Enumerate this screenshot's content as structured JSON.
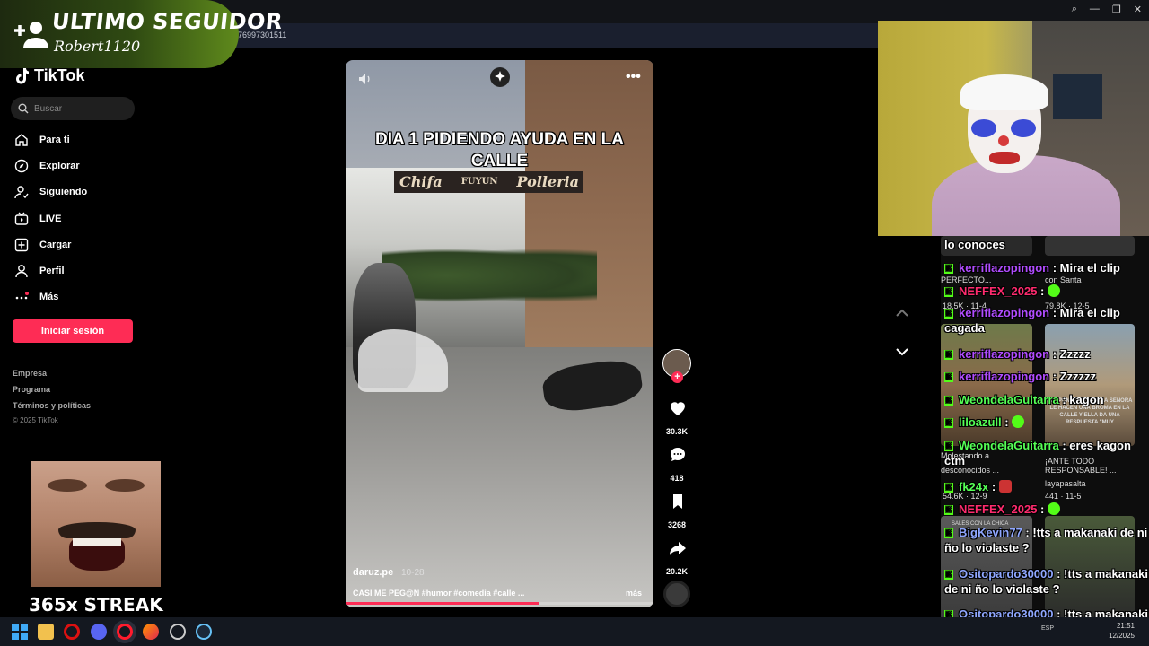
{
  "browser": {
    "url_fragment": "76997301511",
    "window_icons": [
      "search-icon",
      "minimize-icon",
      "restore-icon",
      "close-icon"
    ]
  },
  "follower_alert": {
    "title": "ULTIMO SEGUIDOR",
    "username": "Robert1120"
  },
  "sidebar": {
    "brand": "TikTok",
    "search_placeholder": "Buscar",
    "nav": [
      {
        "label": "Para ti",
        "icon": "home-icon"
      },
      {
        "label": "Explorar",
        "icon": "compass-icon"
      },
      {
        "label": "Siguiendo",
        "icon": "following-icon"
      },
      {
        "label": "LIVE",
        "icon": "live-icon"
      },
      {
        "label": "Cargar",
        "icon": "upload-icon"
      },
      {
        "label": "Perfil",
        "icon": "profile-icon"
      },
      {
        "label": "Más",
        "icon": "more-icon"
      }
    ],
    "login_label": "Iniciar sesión",
    "footer_links": [
      "Empresa",
      "Programa",
      "Términos y políticas"
    ],
    "copyright": "© 2025 TikTok"
  },
  "overlay": {
    "streak": "365x STREAK"
  },
  "video": {
    "caption": "DIA 1 PIDIENDO AYUDA EN LA CALLE",
    "sign_left": "Chifa",
    "sign_mid": "FUYUN",
    "sign_right": "Polleria",
    "author": "daruz.pe",
    "date": "10-28",
    "description": "CASI ME PEG@N #humor #comedia #calle ...",
    "more_label": "más",
    "progress": 0.63
  },
  "actions": {
    "likes": "30.3K",
    "comments": "418",
    "saves": "3268",
    "shares": "20.2K"
  },
  "grid_texts": {
    "t1": "PERFECTO...",
    "t2": "con Santa",
    "t3": "18.5K · 11-4",
    "t4": "79.8K · 12-5",
    "t5": "Molestando a",
    "t6": "desconocidos ...",
    "t7": "¡ANTE TODO",
    "t8": "RESPONSABLE! ...",
    "t9": "layapasalta",
    "t10": "54.6K · 12-9",
    "t11": "441 · 11-5",
    "t12": "RESPONSABLE! A UNA SEÑORA LE HACEN UNA BROMA EN LA CALLE Y ELLA DA UNA RESPUESTA \"MUY",
    "t13": "SALES CON LA CHICA"
  },
  "chat": [
    {
      "user": "",
      "text": "lo conoces",
      "color": "#ffffff"
    },
    {
      "user": "kerriflazopingon",
      "text": " : Mira el clip",
      "color": "#b14cff"
    },
    {
      "user": "NEFFEX_2025",
      "text": " : ",
      "color": "#ff2b6e"
    },
    {
      "user": "kerriflazopingon",
      "text": " : Mira el clip cagada",
      "color": "#b14cff"
    },
    {
      "user": "kerriflazopingon",
      "text": " : Zzzzz",
      "color": "#b14cff"
    },
    {
      "user": "kerriflazopingon",
      "text": " : Zzzzzz",
      "color": "#b14cff"
    },
    {
      "user": "WeondelaGuitarra",
      "text": " : kagon",
      "color": "#55ff55"
    },
    {
      "user": "liloazull",
      "text": " : ",
      "color": "#55ff55"
    },
    {
      "user": "WeondelaGuitarra",
      "text": " : eres kagon ctm",
      "color": "#55ff55"
    },
    {
      "user": "fk24x",
      "text": " : ",
      "color": "#55ff55"
    },
    {
      "user": "NEFFEX_2025",
      "text": " : ",
      "color": "#ff2b6e"
    },
    {
      "user": "BigKevin77",
      "text": " : !tts a makanaki de ni ño lo violaste ?",
      "color": "#8fa7ff"
    },
    {
      "user": "Ositopardo30000",
      "text": " : !tts a makanaki de ni ño lo violaste ?",
      "color": "#8fa7ff"
    },
    {
      "user": "Ositopardo30000",
      "text": " : !tts a makanaki de ni ño lo violaste ?",
      "color": "#8fa7ff"
    }
  ],
  "chat_badge": "K",
  "taskbar": {
    "time": "21:51",
    "date": "12/2025",
    "lang": "ESP"
  }
}
